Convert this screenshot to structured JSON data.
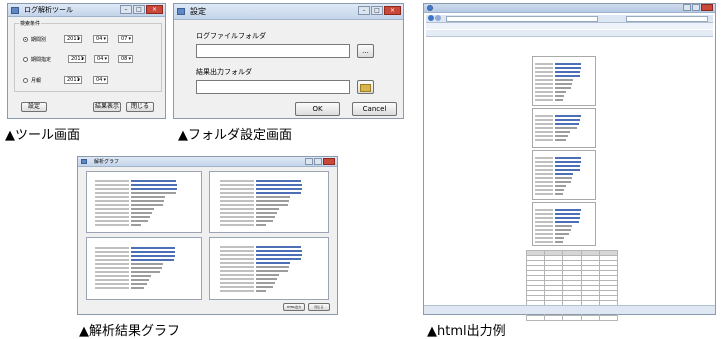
{
  "captions": {
    "tool": "▲ツール画面",
    "folder": "▲フォルダ設定画面",
    "graph": "▲解析結果グラフ",
    "html": "▲html出力例"
  },
  "tool_window": {
    "title": "ログ解析ツール",
    "conditions_label": "検索条件",
    "radio_options": [
      "期間別",
      "期間指定",
      "月報"
    ],
    "selected_option": "期間別",
    "row1": {
      "year": "2011",
      "month": "04",
      "day": "07"
    },
    "row2": {
      "from_year": "2011",
      "month": "04",
      "day": "08"
    },
    "row3": {
      "year": "2011",
      "month": "04"
    },
    "settings_button": "設定",
    "show_results_button": "結果表示",
    "close_button": "閉じる"
  },
  "folder_window": {
    "title": "設定",
    "log_folder_label": "ログファイルフォルダ",
    "log_folder_value": "",
    "browse_label": "...",
    "result_folder_label": "結果出力フォルダ",
    "result_folder_value": "",
    "ok_button": "OK",
    "cancel_button": "Cancel"
  },
  "graph_window": {
    "title": "解析グラフ",
    "panel_titles": [
      "総数",
      "",
      "",
      ""
    ],
    "bottom_buttons": [
      "HTML出力",
      "閉じる"
    ]
  },
  "colors": {
    "bar_primary": "#4d6fb6",
    "bar_secondary": "#9d9d9d",
    "ie_toolbar": "#dde7f4"
  }
}
